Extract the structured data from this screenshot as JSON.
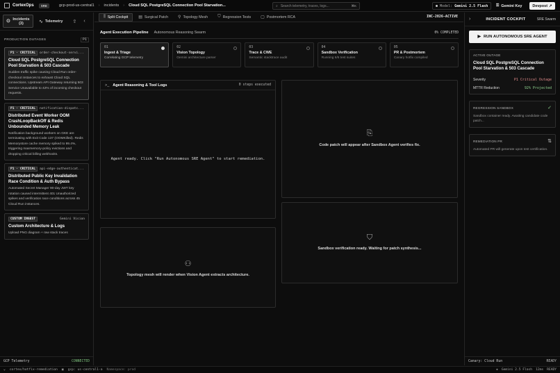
{
  "app": {
    "name": "CortexOps",
    "env_chip": "SRE"
  },
  "breadcrumbs": [
    "gcp-prod-us-central1",
    "incidents",
    "Cloud SQL PostgreSQL Connection Pool Starvation..."
  ],
  "search": {
    "placeholder": "Search telemetry, traces, logs...",
    "shortcut": "⌘K"
  },
  "model": {
    "label": "Model:",
    "value": "Gemini 2.5 Flash"
  },
  "gemini_key": "Gemini Key",
  "devpost": "Devpost",
  "sidebar": {
    "tabs": {
      "incidents": "Incidents (3)",
      "telemetry": "Telemetry"
    },
    "section_title": "PRODUCTION OUTAGES",
    "section_badge": "P1",
    "cards": [
      {
        "badge": "P1 · CRITICAL",
        "service": "order-checkout-servi...",
        "title": "Cloud SQL PostgreSQL Connection Pool Starvation & 503 Cascade",
        "desc": "Sudden traffic spike causing Cloud Run order-checkout instances to exhaust Cloud SQL connections. Upstream API Gateway returning 503 Service Unavailable to 42% of incoming checkout requests."
      },
      {
        "badge": "P1 · CRITICAL",
        "service": "notification-dispatc...",
        "title": "Distributed Event Worker OOM CrashLoopBackOff & Redis Unbounded Memory Leak",
        "desc": "Notification background workers on GKE are terminating with Exit Code 137 (OOMKilled). Redis Memorystore cache memory spiked to 99.4%, triggering maxmemory-policy evictions and dropping critical billing webhooks."
      },
      {
        "badge": "P1 · CRITICAL",
        "service": "api-edge-authenticat...",
        "title": "Distributed Public Key Invalidation Race Condition & Auth Bypass",
        "desc": "Automated Secret Manager 90-day JWT key rotation caused intermittent 401 Unauthorized spikes and verification race conditions across 45 Cloud Run instances."
      },
      {
        "badge": "CUSTOM INGEST",
        "service": "Gemini Vision",
        "title": "Custom Architecture & Logs",
        "desc": "Upload PNG diagram + raw stack traces"
      }
    ],
    "footer": {
      "label": "GCP Telemetry",
      "status": "CONNECTED"
    }
  },
  "main": {
    "tabs": [
      "Split Cockpit",
      "Surgical Patch",
      "Topology Mesh",
      "Regression Tests",
      "Postmortem RCA"
    ],
    "incident_id": "INC-2026-ACTIVE",
    "pipeline": {
      "title": "Agent Execution Pipeline",
      "subtitle": "Autonomous Reasoning Swarm",
      "progress_label": "0% COMPLETED",
      "progress": 0
    },
    "steps": [
      {
        "n": "01",
        "name": "Ingest & Triage",
        "desc": "Correlating GCP telemetry"
      },
      {
        "n": "02",
        "name": "Vision Topology",
        "desc": "Gemini architecture parser"
      },
      {
        "n": "03",
        "name": "Trace & CWE",
        "desc": "Semantic stacktrace audit"
      },
      {
        "n": "04",
        "name": "Sandbox Verification",
        "desc": "Running 6/6 test suites"
      },
      {
        "n": "05",
        "name": "PR & Postmortem",
        "desc": "Canary hotfix compiled"
      }
    ],
    "logs": {
      "title": "Agent Reasoning & Tool Logs",
      "count": "0 steps executed",
      "message": "Agent ready. Click \"Run Autonomous SRE Agent\" to start remediation."
    },
    "code_placeholder": "Code patch will appear after Sandbox Agent verifies fix.",
    "sandbox_placeholder": "Sandbox verification ready. Waiting for patch synthesis...",
    "topology_placeholder": "Topology mesh will render when Vision Agent extracts architecture."
  },
  "right": {
    "title": "INCIDENT COCKPIT",
    "swarm": "SRE Swarm",
    "run_button": "RUN AUTONOMOUS SRE AGENT",
    "active": {
      "label": "ACTIVE OUTAGE",
      "title": "Cloud SQL PostgreSQL Connection Pool Starvation & 503 Cascade",
      "severity_label": "Severity",
      "severity": "P1 Critical Outage",
      "mttr_label": "MTTR Reduction",
      "mttr": "92% Projected"
    },
    "sandbox": {
      "label": "REGRESSION SANDBOX",
      "text": "Sandbox container ready. Awaiting candidate code patch..."
    },
    "pr": {
      "label": "REMEDIATION PR",
      "text": "Automated PR will generate upon test certification."
    },
    "footer": {
      "label": "Canary: Cloud Run",
      "status": "READY"
    }
  },
  "statusbar": {
    "branch": "cortex/hotfix-remediation",
    "region": "gcp: us-central1-a",
    "namespace": "Namespace: prod",
    "model": "Gemini 2.5 Flash",
    "latency": "12ms",
    "state": "READY"
  }
}
